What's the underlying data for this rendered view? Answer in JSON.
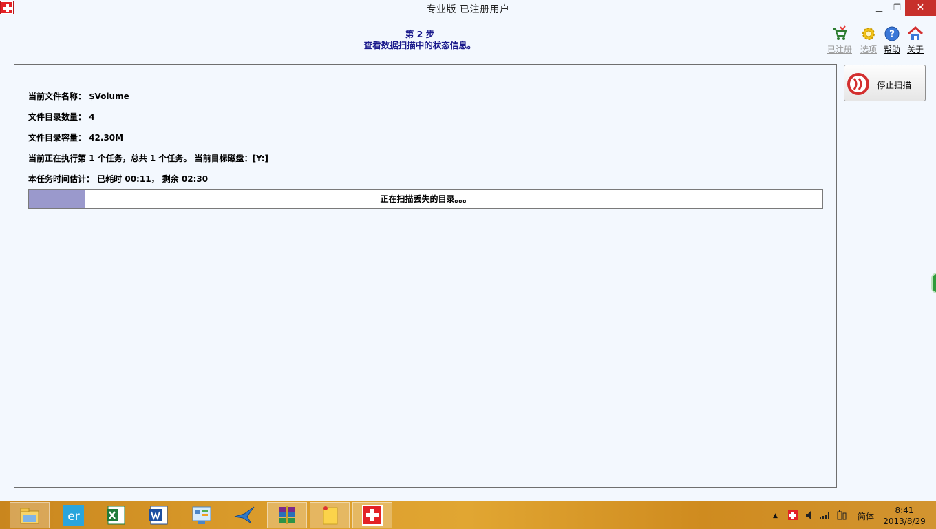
{
  "window": {
    "title": "专业版   已注册用户",
    "minimize": "▪",
    "restore": "❐",
    "close": "✕"
  },
  "header": {
    "step": "第 2 步",
    "subtitle": "查看数据扫描中的状态信息。"
  },
  "toolbar": [
    {
      "label": "已注册",
      "icon": "cart-icon",
      "enabled": false
    },
    {
      "label": "选项",
      "icon": "gear-icon",
      "enabled": false
    },
    {
      "label": "帮助",
      "icon": "help-icon",
      "enabled": true
    },
    {
      "label": "关于",
      "icon": "home-icon",
      "enabled": true
    }
  ],
  "scan": {
    "current_file_label": "当前文件名称：",
    "current_file": "$Volume",
    "dir_count_label": "文件目录数量：",
    "dir_count": "4",
    "dir_size_label": "文件目录容量：",
    "dir_size": "42.30M",
    "task_line": "当前正在执行第 1 个任务，总共 1 个任务。 当前目标磁盘：[Y:]",
    "time_line": "本任务时间估计： 已耗时 00:11，  剩余 02:30",
    "progress_text": "正在扫描丢失的目录。。。",
    "progress_fraction": 0.07
  },
  "stop_button": {
    "label": "停止扫描",
    "icon": "stop-icon"
  },
  "taskbar": {
    "apps": [
      {
        "name": "file-explorer-icon"
      },
      {
        "name": "er-app-icon",
        "text": "er"
      },
      {
        "name": "excel-icon"
      },
      {
        "name": "word-icon"
      },
      {
        "name": "control-panel-icon"
      },
      {
        "name": "bird-app-icon"
      },
      {
        "name": "winrar-icon"
      },
      {
        "name": "sticky-notes-icon"
      },
      {
        "name": "recovery-app-icon"
      }
    ],
    "ime": "简体",
    "time": "8:41",
    "date": "2013/8/29"
  }
}
